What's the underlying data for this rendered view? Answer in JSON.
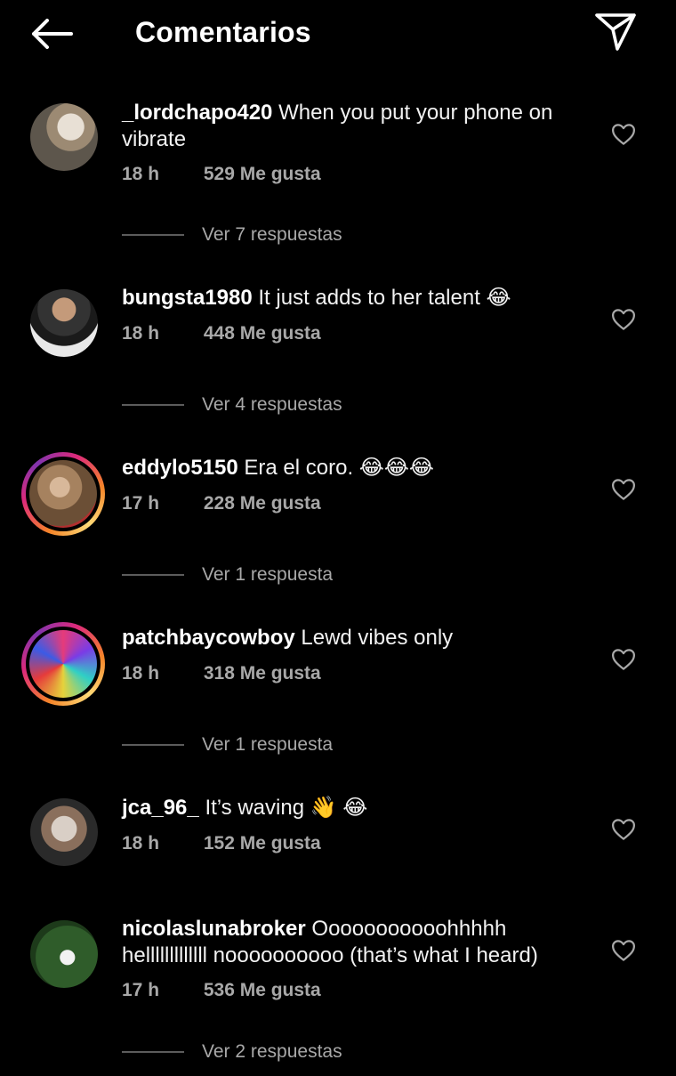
{
  "header": {
    "title": "Comentarios",
    "back_icon": "arrow-left-icon",
    "send_icon": "paper-plane-icon"
  },
  "comments": [
    {
      "username": "_lordchapo420",
      "text": "When you put your phone on vibrate",
      "time": "18 h",
      "likes": "529 Me gusta",
      "replies": "Ver 7 respuestas",
      "story_ring": false
    },
    {
      "username": "bungsta1980",
      "text": "It just adds to her talent 😂",
      "time": "18 h",
      "likes": "448 Me gusta",
      "replies": "Ver 4 respuestas",
      "story_ring": false
    },
    {
      "username": "eddylo5150",
      "text": "Era el coro. 😂😂😂",
      "time": "17 h",
      "likes": "228 Me gusta",
      "replies": "Ver 1 respuesta",
      "story_ring": true
    },
    {
      "username": "patchbaycowboy",
      "text": "Lewd vibes only",
      "time": "18 h",
      "likes": "318 Me gusta",
      "replies": "Ver 1 respuesta",
      "story_ring": true
    },
    {
      "username": "jca_96_",
      "text": "It’s waving 👋 😂",
      "time": "18 h",
      "likes": "152 Me gusta",
      "replies": "",
      "story_ring": false
    },
    {
      "username": "nicolaslunabroker",
      "text": "Ooooooooooohhhhh helllllllllllll noooooooooo (that’s what I heard)",
      "time": "17 h",
      "likes": "536 Me gusta",
      "replies": "Ver 2 respuestas",
      "story_ring": false
    }
  ],
  "colors": {
    "background": "#000000",
    "secondary_text": "#a8a8a8",
    "ring_start": "#f58529",
    "ring_end": "#dd2a7b"
  }
}
